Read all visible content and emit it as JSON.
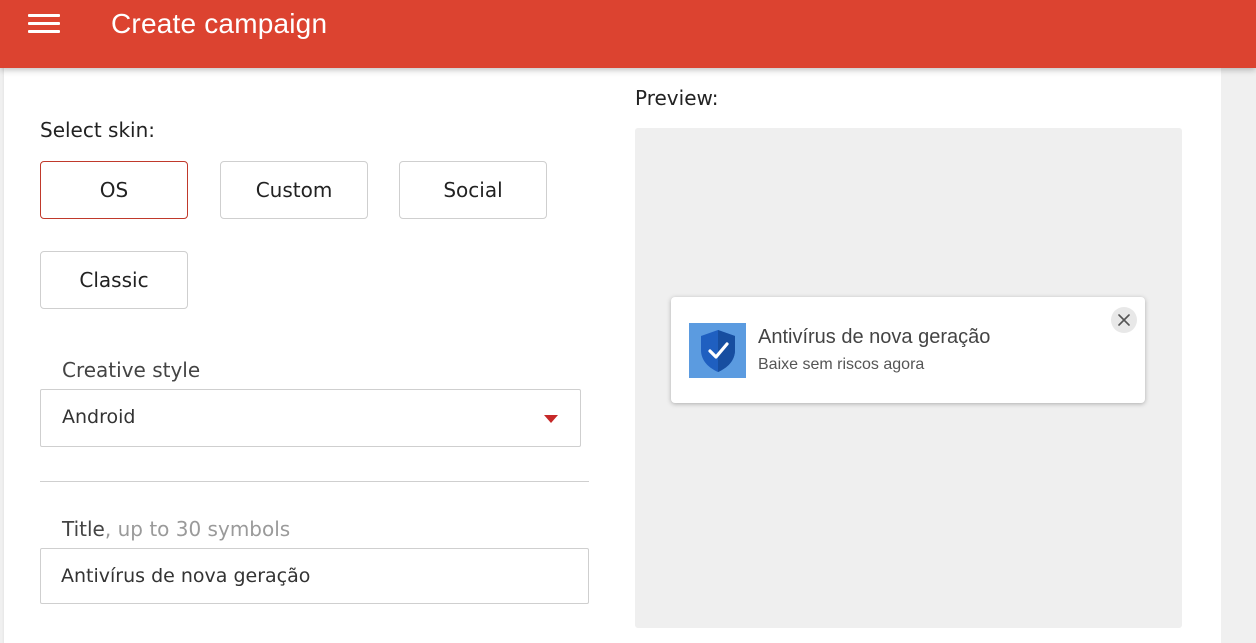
{
  "header": {
    "title": "Create campaign",
    "menu_icon": "hamburger-menu-icon",
    "bg_color": "#dc4330"
  },
  "skin": {
    "label": "Select skin:",
    "options": [
      "OS",
      "Custom",
      "Social",
      "Classic"
    ],
    "selected": "OS",
    "selected_border_color": "#c0392b"
  },
  "creative_style": {
    "label": "Creative style",
    "value": "Android"
  },
  "title_field": {
    "label": "Title",
    "hint": ", up to 30 symbols",
    "value": "Antivírus de nova geração"
  },
  "preview": {
    "label": "Preview:",
    "notification": {
      "icon": "shield-check-icon",
      "title": "Antivírus de nova geração",
      "body": "Baixe sem riscos agora",
      "close_icon": "close-icon"
    }
  }
}
